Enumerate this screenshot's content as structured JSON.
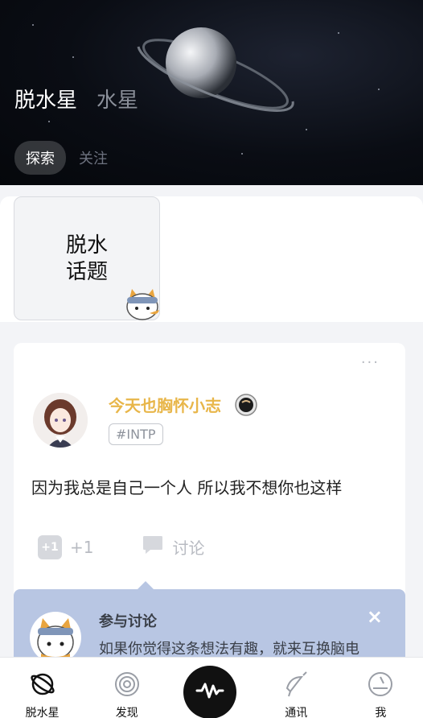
{
  "header": {
    "title": "脱水星",
    "subtitle": "水星",
    "tabs": [
      {
        "label": "探索",
        "active": true
      },
      {
        "label": "关注",
        "active": false
      }
    ]
  },
  "topics": {
    "card_label": "脱水\n话题"
  },
  "post": {
    "more": "···",
    "username": "今天也胸怀小志",
    "mbti": "#INTP",
    "text": "因为我总是自己一个人 所以我不想你也这样",
    "plus_label": "+1",
    "plus_count": "+1",
    "discuss_label": "讨论"
  },
  "tooltip": {
    "title": "参与讨论",
    "description": "如果你觉得这条想法有趣，就来互换脑电",
    "close": "×"
  },
  "nav": {
    "items": [
      {
        "label": "脱水星",
        "icon": "planet-icon",
        "active": true
      },
      {
        "label": "发现",
        "icon": "spiral-icon",
        "active": false
      },
      {
        "label": "",
        "icon": "wave-icon",
        "active": false
      },
      {
        "label": "通讯",
        "icon": "satellite-icon",
        "active": false
      },
      {
        "label": "我",
        "icon": "profile-icon",
        "active": false
      }
    ]
  },
  "colors": {
    "accent": "#e8b64a",
    "tooltip_bg": "#b8c6e3",
    "header_bg": "#0a0d14"
  }
}
